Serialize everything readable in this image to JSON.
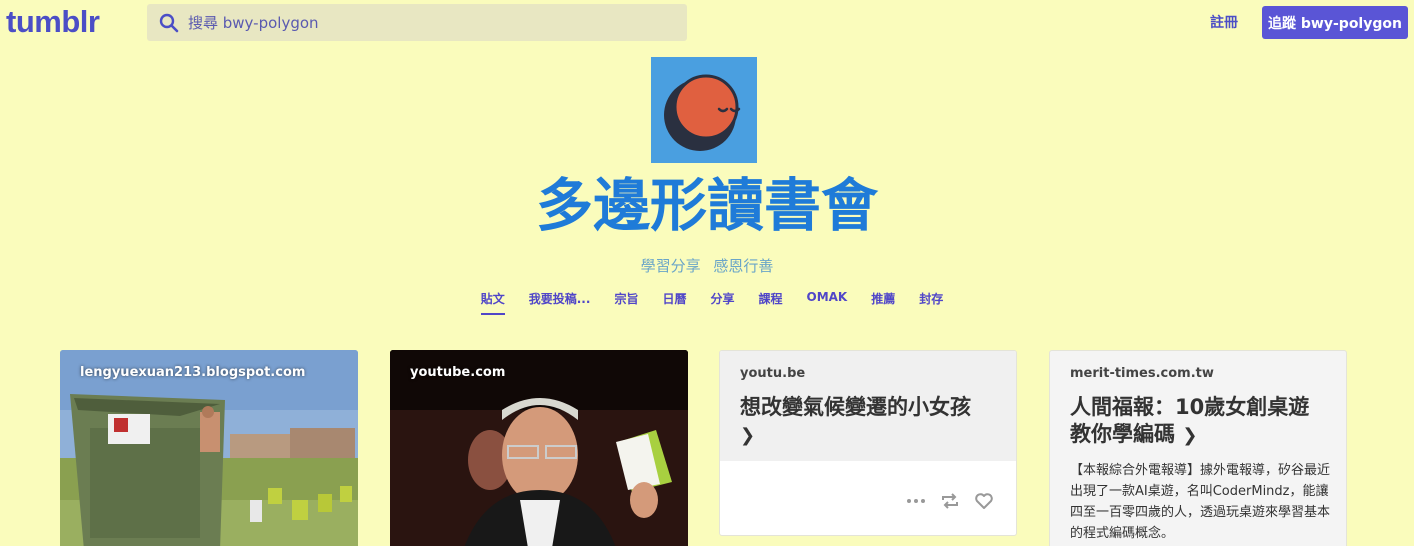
{
  "header": {
    "logo": "tumblr",
    "search_placeholder": "搜尋 bwy-polygon",
    "register_label": "註冊",
    "follow_label": "追蹤 bwy-polygon"
  },
  "blog": {
    "title": "多邊形讀書會",
    "description": "學習分享 感恩行善"
  },
  "nav": [
    "貼文",
    "我要投稿...",
    "宗旨",
    "日曆",
    "分享",
    "課程",
    "OMAK",
    "推薦",
    "封存"
  ],
  "posts": [
    {
      "source": "lengyuexuan213.blogspot.com",
      "type": "photo"
    },
    {
      "source": "youtube.com",
      "type": "video"
    },
    {
      "source": "youtu.be",
      "type": "link",
      "title": "想改變氣候變遷的小女孩"
    },
    {
      "source": "merit-times.com.tw",
      "type": "link",
      "title": "人間福報：10歲女創桌遊教你學編碼",
      "excerpt": "【本報綜合外電報導】據外電報導，矽谷最近出現了一款AI桌遊，名叫CoderMindz，能讓四至一百零四歲的人，透過玩桌遊來學習基本的程式編碼概念。"
    }
  ],
  "colors": {
    "accent": "#5a55d6",
    "background": "#fafcbc",
    "title": "#1f7bd8"
  }
}
